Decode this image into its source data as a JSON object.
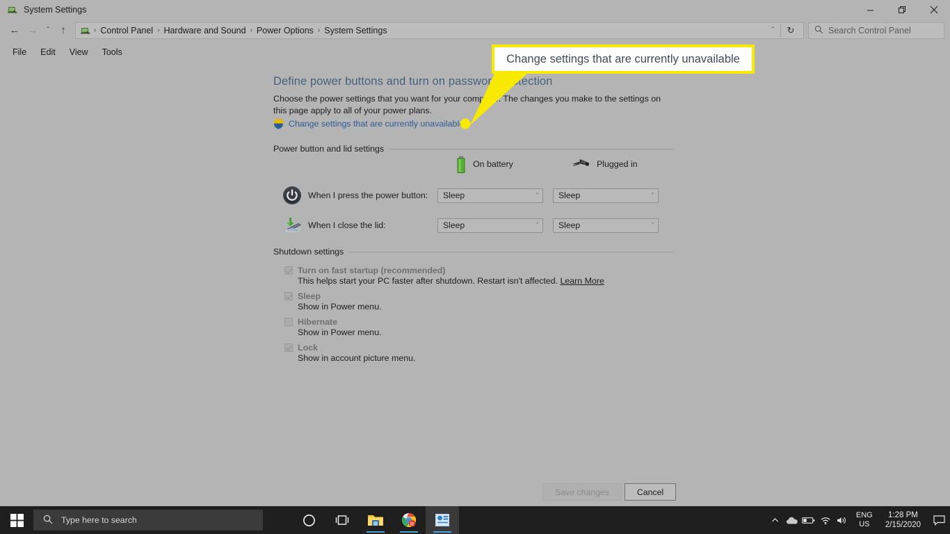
{
  "window": {
    "title": "System Settings",
    "app_icon": "system-settings-icon",
    "controls": {
      "minimize": "—",
      "restore": "❐",
      "close": "✕"
    }
  },
  "addressbar": {
    "back": "←",
    "forward": "→",
    "recent": "ˇ",
    "up": "↑",
    "breadcrumbs": [
      "Control Panel",
      "Hardware and Sound",
      "Power Options",
      "System Settings"
    ],
    "separator": "›",
    "dropdown_chevron": "ˇ",
    "refresh": "↻"
  },
  "search": {
    "placeholder": "Search Control Panel",
    "icon": "search-icon"
  },
  "menubar": {
    "items": [
      "File",
      "Edit",
      "View",
      "Tools"
    ]
  },
  "main": {
    "heading": "Define power buttons and turn on password protection",
    "description": "Choose the power settings that you want for your computer. The changes you make to the settings on this page apply to all of your power plans.",
    "uac_link": "Change settings that are currently unavailable",
    "uac_icon": "shield-icon"
  },
  "power_section": {
    "title": "Power button and lid settings",
    "columns": [
      {
        "label": "On battery",
        "icon": "battery-icon"
      },
      {
        "label": "Plugged in",
        "icon": "power-plug-icon"
      }
    ],
    "rows": [
      {
        "label": "When I press the power button:",
        "icon": "power-button-icon",
        "on_battery": "Sleep",
        "plugged_in": "Sleep"
      },
      {
        "label": "When I close the lid:",
        "icon": "laptop-lid-icon",
        "on_battery": "Sleep",
        "plugged_in": "Sleep"
      }
    ],
    "combo_arrow": "ˇ"
  },
  "shutdown_section": {
    "title": "Shutdown settings",
    "items": [
      {
        "label": "Turn on fast startup (recommended)",
        "checked": true,
        "sub": "This helps start your PC faster after shutdown. Restart isn't affected.",
        "link": "Learn More"
      },
      {
        "label": "Sleep",
        "checked": true,
        "sub": "Show in Power menu.",
        "link": ""
      },
      {
        "label": "Hibernate",
        "checked": false,
        "sub": "Show in Power menu.",
        "link": ""
      },
      {
        "label": "Lock",
        "checked": true,
        "sub": "Show in account picture menu.",
        "link": ""
      }
    ]
  },
  "buttons": {
    "save": "Save changes",
    "cancel": "Cancel"
  },
  "annotation": {
    "text": "Change settings that are currently unavailable",
    "border_color": "#f7e900",
    "text_color": "#3f4a57"
  },
  "taskbar": {
    "start": "start-button",
    "search_placeholder": "Type here to search",
    "search_icon": "search-icon",
    "cortana": "cortana-icon",
    "taskview": "task-view-icon",
    "apps": [
      "file-explorer-icon",
      "chrome-icon",
      "control-panel-icon"
    ],
    "tray": {
      "chevron": "˄",
      "onedrive": "onedrive-icon",
      "battery": "battery-icon",
      "wifi": "wifi-icon",
      "volume": "volume-icon",
      "lang_line1": "ENG",
      "lang_line2": "US",
      "time": "1:28 PM",
      "date": "2/15/2020",
      "notifications": "notification-icon"
    }
  },
  "theme": {
    "window_bg": "#b4b4b4",
    "heading_color": "#46617d",
    "link_color": "#2a5d96",
    "taskbar_bg": "#1f1f1f"
  }
}
